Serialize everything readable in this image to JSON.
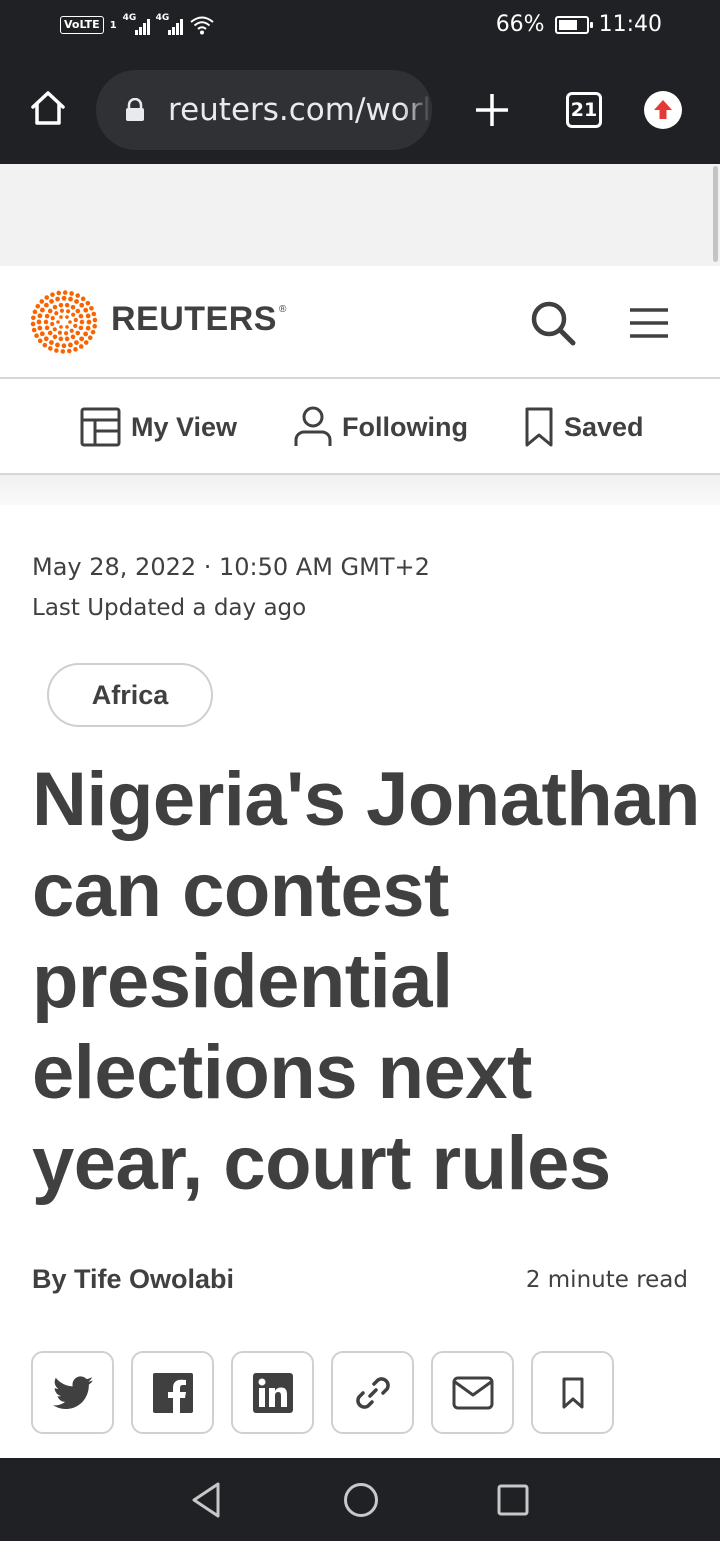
{
  "status_bar": {
    "carrier_badge": "VoLTE",
    "sim_index": "1",
    "network_1": "4G",
    "network_2": "4G",
    "battery_percent": "66%",
    "battery_level": 0.66,
    "time": "11:40"
  },
  "browser": {
    "url": "reuters.com/world",
    "tab_count": "21",
    "icons": {
      "home": "home-icon",
      "lock": "lock-icon",
      "new_tab": "plus-icon",
      "tabs": "tab-switcher-icon",
      "update": "arrow-up-icon"
    },
    "load_progress": 0.8
  },
  "site": {
    "logo_text": "REUTERS",
    "logo_registered": "®",
    "brand_color": "#fa6400",
    "icons": {
      "search": "search-icon",
      "menu": "hamburger-menu-icon"
    }
  },
  "subnav": {
    "items": [
      {
        "label": "My View",
        "icon": "layout-icon"
      },
      {
        "label": "Following",
        "icon": "person-icon"
      },
      {
        "label": "Saved",
        "icon": "bookmark-icon"
      }
    ]
  },
  "article": {
    "date": "May 28, 2022 · 10:50 AM GMT+2",
    "updated": "Last Updated a day ago",
    "tag": "Africa",
    "headline": "Nigeria's Jonathan can contest presidential elections next year, court rules",
    "byline": "By Tife Owolabi",
    "read_time": "2 minute read"
  },
  "share": {
    "buttons": [
      {
        "name": "twitter",
        "icon": "twitter-icon"
      },
      {
        "name": "facebook",
        "icon": "facebook-icon"
      },
      {
        "name": "linkedin",
        "icon": "linkedin-icon"
      },
      {
        "name": "copy-link",
        "icon": "link-icon"
      },
      {
        "name": "email",
        "icon": "email-icon"
      },
      {
        "name": "save",
        "icon": "bookmark-icon"
      }
    ]
  },
  "nav_bar": {
    "icons": [
      "back-triangle-icon",
      "home-circle-icon",
      "recents-square-icon"
    ]
  }
}
